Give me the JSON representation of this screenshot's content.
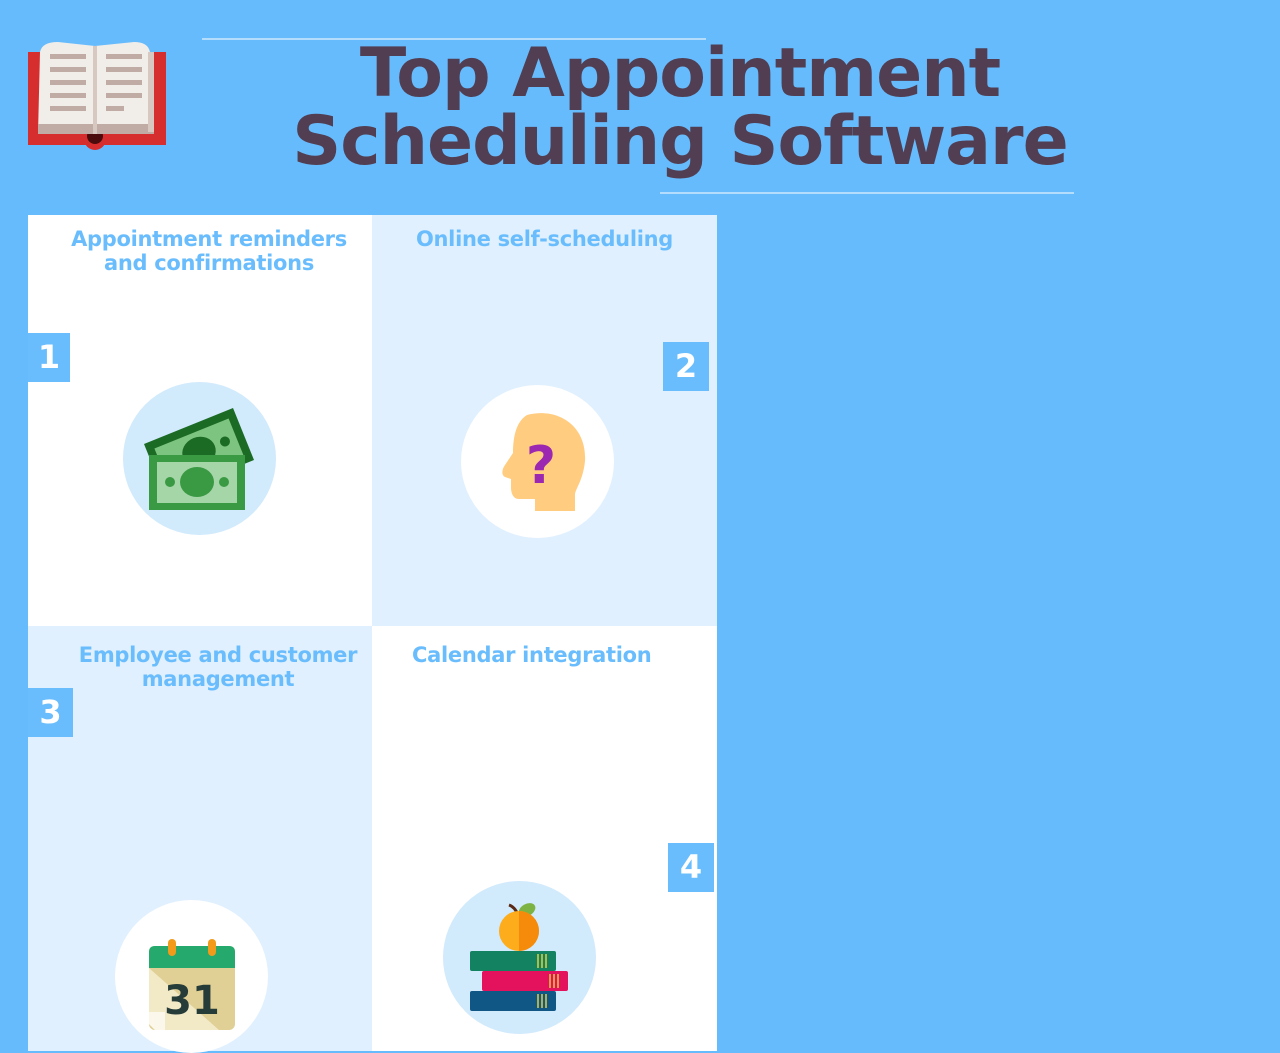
{
  "header": {
    "title_line1": "Top Appointment",
    "title_line2": "Scheduling Software",
    "logo_icon": "open-book-icon"
  },
  "features": [
    {
      "number": "1",
      "title_line1": "Appointment reminders",
      "title_line2": "and confirmations",
      "icon": "money-bills-icon"
    },
    {
      "number": "2",
      "title_line1": "Online self-scheduling",
      "title_line2": "",
      "icon": "head-question-icon"
    },
    {
      "number": "3",
      "title_line1": "Employee and customer",
      "title_line2": "management",
      "icon": "calendar-icon",
      "icon_text": "31"
    },
    {
      "number": "4",
      "title_line1": "Calendar integration",
      "title_line2": "",
      "icon": "books-apple-icon"
    }
  ],
  "colors": {
    "background": "#66bbfd",
    "title": "#523e52",
    "accent": "#6abdfd",
    "tile_light": "#e0f0fe",
    "tile_white": "#ffffff"
  }
}
